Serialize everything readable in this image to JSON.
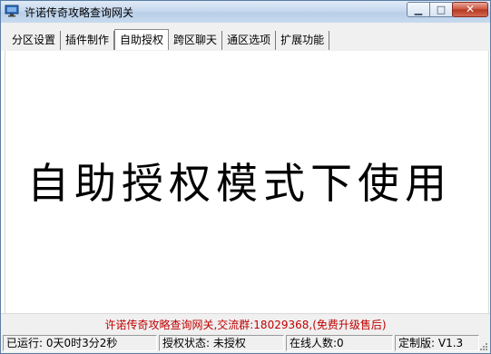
{
  "window": {
    "title": "许诺传奇攻略查询网关",
    "minimize_glyph": "▁",
    "maximize_glyph": "□",
    "close_glyph": "✕"
  },
  "tabs": [
    {
      "label": "分区设置",
      "active": false
    },
    {
      "label": "插件制作",
      "active": false
    },
    {
      "label": "自助授权",
      "active": true
    },
    {
      "label": "跨区聊天",
      "active": false
    },
    {
      "label": "通区选项",
      "active": false
    },
    {
      "label": "扩展功能",
      "active": false
    }
  ],
  "content": {
    "mode_text": "自助授权模式下使用"
  },
  "footer": {
    "info": "许诺传奇攻略查询网关,交流群:18029368,(免费升级售后)"
  },
  "statusbar": {
    "runtime": "已运行: 0天0时3分2秒",
    "auth_status": "授权状态: 未授权",
    "online": "在线人数:0",
    "edition": "定制版: V1.3"
  },
  "colors": {
    "footer_text": "#c00000",
    "titlebar": "#c7d9ee",
    "close_button": "#c9503b"
  },
  "icons": {
    "app": "monitor-icon",
    "grip": "resize-grip-icon"
  }
}
